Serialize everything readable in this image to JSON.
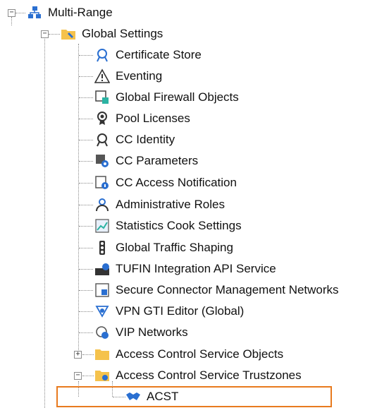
{
  "tree": {
    "root": {
      "label": "Multi-Range",
      "icon": "network-range-icon",
      "expanded": true
    },
    "global_settings": {
      "label": "Global Settings",
      "icon": "settings-folder-icon",
      "expanded": true,
      "items": [
        {
          "label": "Certificate Store",
          "icon": "certificate-store-icon"
        },
        {
          "label": "Eventing",
          "icon": "warning-triangle-icon"
        },
        {
          "label": "Global Firewall Objects",
          "icon": "firewall-objects-icon"
        },
        {
          "label": "Pool Licenses",
          "icon": "license-icon"
        },
        {
          "label": "CC Identity",
          "icon": "identity-badge-icon"
        },
        {
          "label": "CC Parameters",
          "icon": "parameters-gear-icon"
        },
        {
          "label": "CC Access Notification",
          "icon": "access-notification-icon"
        },
        {
          "label": "Administrative Roles",
          "icon": "admin-user-icon"
        },
        {
          "label": "Statistics Cook Settings",
          "icon": "statistics-icon"
        },
        {
          "label": "Global Traffic Shaping",
          "icon": "traffic-light-icon"
        },
        {
          "label": "TUFIN Integration API Service",
          "icon": "api-service-icon"
        },
        {
          "label": "Secure Connector Management Networks",
          "icon": "connector-network-icon"
        },
        {
          "label": "VPN GTI Editor (Global)",
          "icon": "vpn-gti-icon"
        },
        {
          "label": "VIP Networks",
          "icon": "vip-network-icon"
        },
        {
          "label": "Access Control Service Objects",
          "icon": "folder-icon",
          "expanded": false
        },
        {
          "label": "Access Control Service Trustzones",
          "icon": "settings-folder-icon",
          "expanded": true
        }
      ]
    },
    "acst": {
      "label": "ACST",
      "icon": "handshake-icon",
      "selected": true
    },
    "colors": {
      "selection_border": "#e87a1e",
      "folder": "#f5c24c",
      "icon_blue": "#2a6fd1"
    }
  }
}
